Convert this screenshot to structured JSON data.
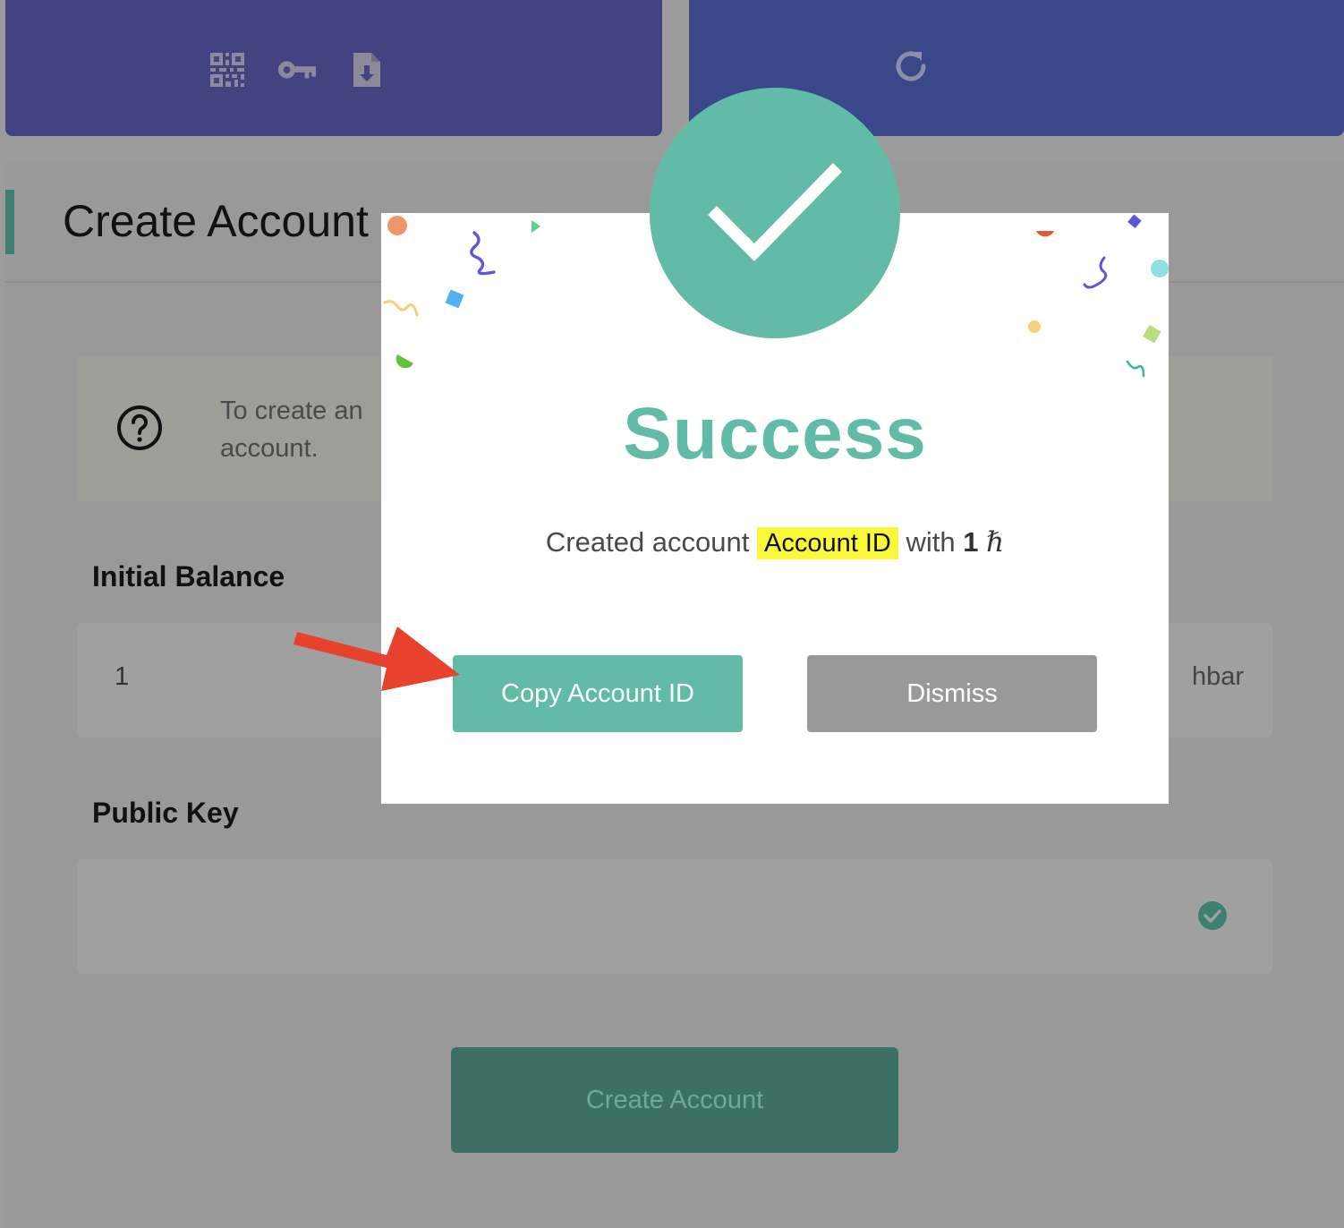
{
  "toolbar": {
    "left_icons": [
      "qr-code-icon",
      "key-icon",
      "file-download-icon"
    ],
    "right_icons": [
      "refresh-icon"
    ]
  },
  "page": {
    "title": "Create Account",
    "info_text": "To create an account.",
    "info_text_line1": "To create an",
    "info_text_line2": "account.",
    "info_icon": "question-circle-icon"
  },
  "form": {
    "initial_balance_label": "Initial Balance",
    "initial_balance_value": "1",
    "initial_balance_unit": "hbar",
    "public_key_label": "Public Key",
    "public_key_value": "",
    "public_key_status_icon": "check-circle-icon",
    "submit_label": "Create Account"
  },
  "modal": {
    "status_icon": "checkmark-icon",
    "title": "Success",
    "message_prefix": "Created account",
    "account_id": "Account ID",
    "message_mid": "with",
    "amount": "1",
    "currency_symbol": "ℏ",
    "copy_button_label": "Copy Account ID",
    "dismiss_button_label": "Dismiss"
  },
  "annotation": {
    "arrow_icon": "red-arrow-icon",
    "arrow_color": "#e8412c"
  },
  "colors": {
    "accent": "#62bba7",
    "highlight": "#fbf83b",
    "top_left_card": "#424380",
    "top_right_card": "#3a4889",
    "dismiss": "#999999"
  }
}
